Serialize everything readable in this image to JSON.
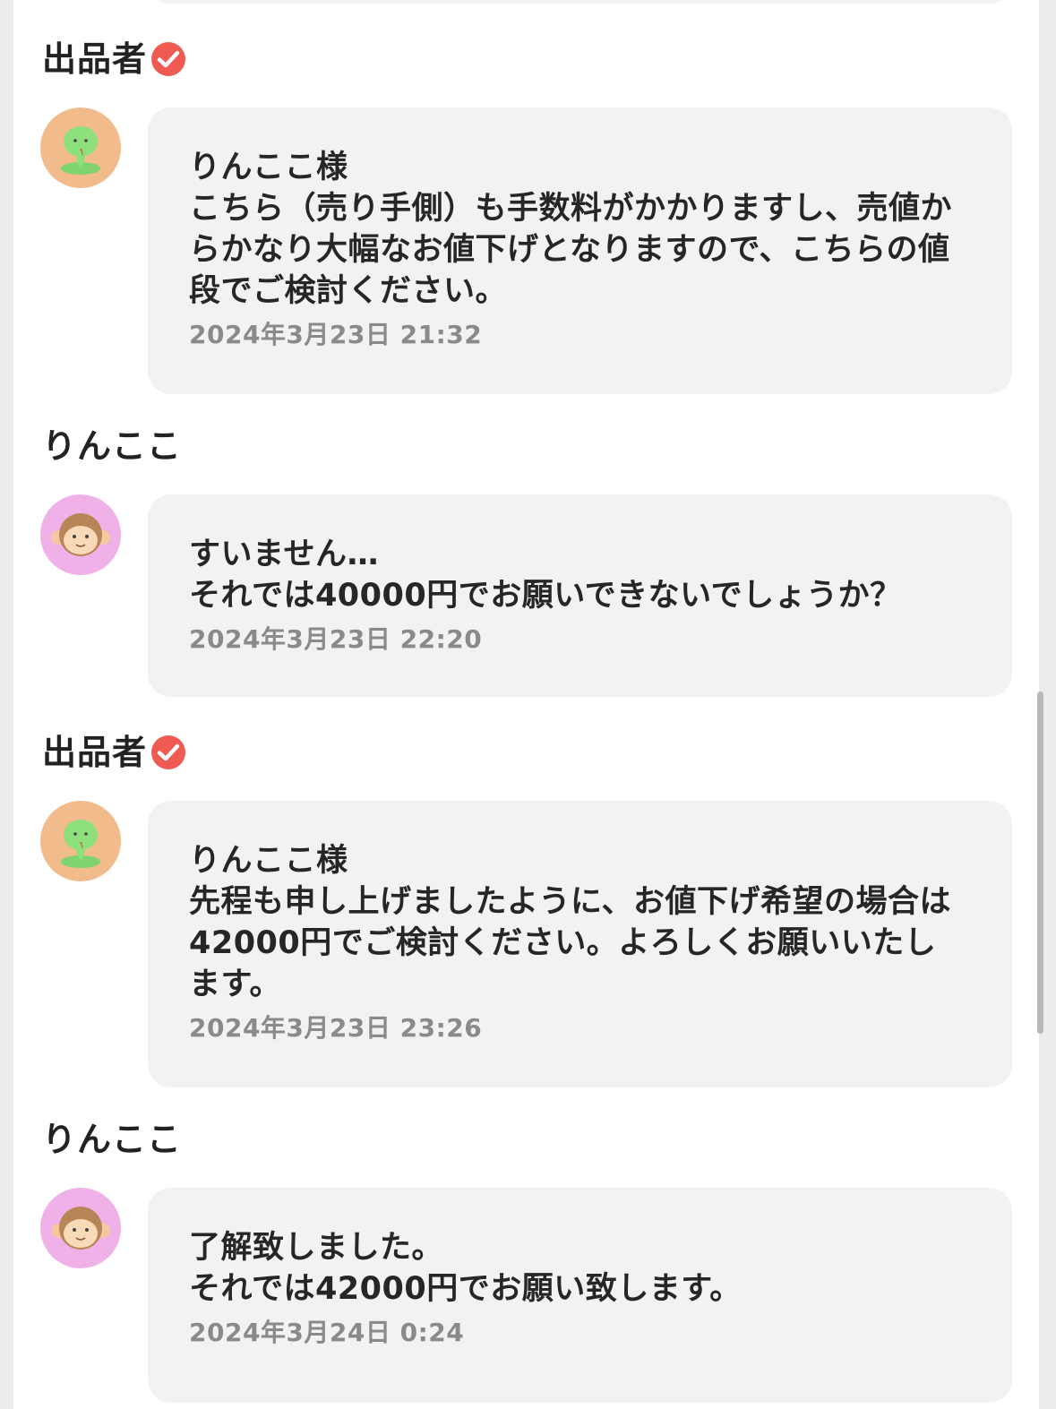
{
  "colors": {
    "background": "#ffffff",
    "bubble": "#f2f2f2",
    "verified_badge": "#ef5a52",
    "timestamp": "#8a8a8a",
    "seller_avatar": "#f2bb8c",
    "buyer_avatar": "#f0b0e8"
  },
  "messages": [
    {
      "sender": "出品者",
      "verified": true,
      "avatar_icon": "snake-avatar-icon",
      "lines": [
        "りんここ様",
        "こちら（売り手側）も手数料がかかりますし、売値か",
        "らかなり大幅なお値下げとなりますので、こちらの値",
        "段でご検討ください。"
      ],
      "time": "2024年3月23日 21:32"
    },
    {
      "sender": "りんここ",
      "verified": false,
      "avatar_icon": "monkey-avatar-icon",
      "lines": [
        "すいません…",
        "それでは40000円でお願いできないでしょうか？"
      ],
      "time": "2024年3月23日 22:20"
    },
    {
      "sender": "出品者",
      "verified": true,
      "avatar_icon": "snake-avatar-icon",
      "lines": [
        "りんここ様",
        "先程も申し上げましたように、お値下げ希望の場合は",
        "42000円でご検討ください。よろしくお願いいたし",
        "ます。"
      ],
      "time": "2024年3月23日 23:26"
    },
    {
      "sender": "りんここ",
      "verified": false,
      "avatar_icon": "monkey-avatar-icon",
      "lines": [
        "了解致しました。",
        "それでは42000円でお願い致します。"
      ],
      "time": "2024年3月24日 0:24"
    }
  ]
}
